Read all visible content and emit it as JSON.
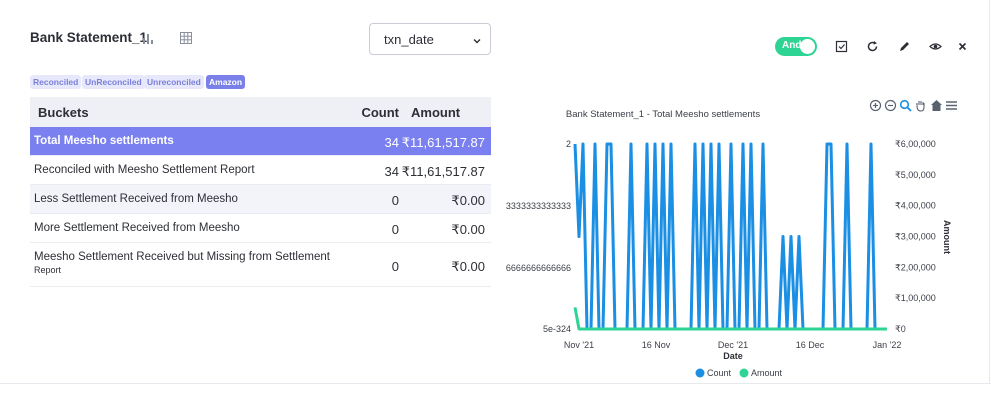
{
  "header": {
    "title": "Bank Statement_1",
    "select_value": "txn_date",
    "toggle_label": "And"
  },
  "chips": [
    {
      "label": "Reconciled",
      "active": false
    },
    {
      "label": "UnReconciled",
      "active": false
    },
    {
      "label": "Unreconciled",
      "active": false
    },
    {
      "label": "Amazon",
      "active": true
    }
  ],
  "table": {
    "headers": {
      "buckets": "Buckets",
      "count": "Count",
      "amount": "Amount"
    },
    "rows": [
      {
        "name": "Total Meesho settlements",
        "count": "34",
        "amount": "₹11,61,517.87"
      },
      {
        "name": "Reconciled with Meesho Settlement Report",
        "count": "34",
        "amount": "₹11,61,517.87"
      },
      {
        "name": "Less Settlement Received from Meesho",
        "count": "0",
        "amount": "₹0.00"
      },
      {
        "name": "More Settlement Received from Meesho",
        "count": "0",
        "amount": "₹0.00"
      },
      {
        "name": "Meesho Settlement Received but Missing from Settlement",
        "name_suffix": "Report",
        "count": "0",
        "amount": "₹0.00"
      }
    ]
  },
  "chart_data": {
    "type": "line",
    "title": "Bank Statement_1 - Total Meesho settlements",
    "xlabel": "Date",
    "ylabel_right": "Amount",
    "x_ticks": [
      "Nov '21",
      "16 Nov",
      "Dec '21",
      "16 Dec",
      "Jan '22"
    ],
    "y_left_ticks": [
      "2",
      "3333333333333",
      "6666666666666",
      "5e-324"
    ],
    "y_right_ticks": [
      "₹6,00,000",
      "₹5,00,000",
      "₹4,00,000",
      "₹3,00,000",
      "₹2,00,000",
      "₹1,00,000",
      "₹0"
    ],
    "y_left_range": [
      0,
      2
    ],
    "y_right_range": [
      0,
      600000
    ],
    "legend": "bottom",
    "series": [
      {
        "name": "Count",
        "color": "#1a8fe3",
        "axis": "left",
        "values": [
          2,
          1,
          2,
          0,
          0,
          2,
          0,
          0,
          2,
          2,
          0,
          0,
          0,
          0,
          2,
          0,
          0,
          0,
          2,
          0,
          2,
          0,
          2,
          0,
          2,
          0,
          0,
          0,
          0,
          0,
          2,
          0,
          2,
          0,
          2,
          0,
          2,
          0,
          0,
          2,
          0,
          0,
          2,
          0,
          2,
          0,
          0,
          2,
          0,
          0,
          0,
          0,
          1,
          0,
          1,
          0,
          1,
          0,
          0,
          0,
          0,
          0,
          0,
          2,
          2,
          0,
          0,
          0,
          2,
          0,
          0,
          0,
          0,
          0,
          2,
          0,
          0,
          0,
          0
        ]
      },
      {
        "name": "Amount",
        "color": "#2ed493",
        "axis": "right",
        "values": [
          70000,
          0,
          0,
          0,
          0,
          0,
          0,
          0,
          0,
          0,
          0,
          0,
          0,
          0,
          0,
          0,
          0,
          0,
          0,
          0,
          0,
          0,
          0,
          0,
          0,
          0,
          0,
          0,
          0,
          0,
          0,
          0,
          0,
          0,
          0,
          0,
          0,
          0,
          0,
          0,
          0,
          0,
          0,
          0,
          0,
          0,
          0,
          0,
          0,
          0,
          0,
          0,
          0,
          0,
          0,
          0,
          0,
          0,
          0,
          0,
          0,
          0,
          0,
          0,
          0,
          0,
          0,
          0,
          0,
          0,
          0,
          0,
          0,
          0,
          0,
          0,
          0,
          0,
          0
        ]
      }
    ]
  }
}
